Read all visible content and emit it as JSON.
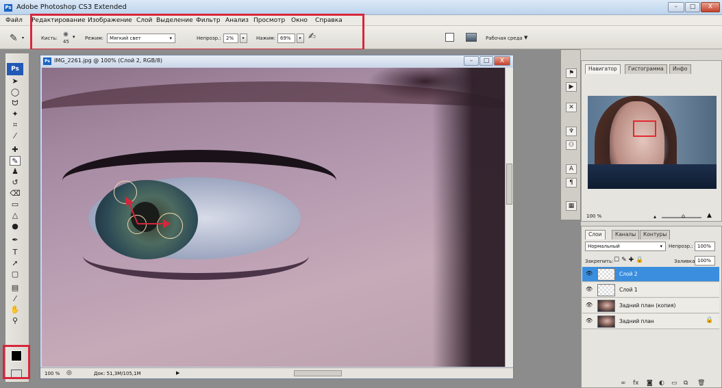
{
  "app": {
    "logo": "Ps",
    "title": "Adobe Photoshop CS3 Extended",
    "window_controls": [
      "–",
      "□",
      "X"
    ]
  },
  "menu": [
    "Файл",
    "Редактирование",
    "Изображение",
    "Слой",
    "Выделение",
    "Фильтр",
    "Анализ",
    "Просмотр",
    "Окно",
    "Справка"
  ],
  "options": {
    "brush_label": "Кисть:",
    "brush_size": "45",
    "mode_label": "Режим:",
    "mode_value": "Мягкий свет",
    "opacity_label": "Непрозр.:",
    "opacity_value": "2%",
    "pressure_label": "Нажим:",
    "pressure_value": "69%",
    "workspace_label": "Рабочая среда"
  },
  "document": {
    "title": "IMG_2261.jpg @ 100% (Слой 2, RGB/8)",
    "zoom": "100 %",
    "doc_size": "Док: 51,3M/105,1M"
  },
  "navigator": {
    "tabs": [
      "Навигатор",
      "Гистограмма",
      "Инфо"
    ],
    "zoom": "100 %"
  },
  "layers_panel": {
    "tabs": [
      "Слои",
      "Каналы",
      "Контуры"
    ],
    "blend_mode": "Нормальный",
    "opacity_label": "Непрозр.:",
    "opacity_value": "100%",
    "lock_label": "Закрепить:",
    "fill_label": "Заливка:",
    "fill_value": "100%",
    "layers": [
      {
        "name": "Слой 2",
        "selected": true,
        "thumb": "transparent"
      },
      {
        "name": "Слой 1",
        "selected": false,
        "thumb": "transparent"
      },
      {
        "name": "Задний план (копия)",
        "selected": false,
        "thumb": "photo"
      },
      {
        "name": "Задний план",
        "selected": false,
        "thumb": "photo",
        "locked": true
      }
    ]
  },
  "colors": {
    "highlight": "#d6263a",
    "selection": "#3b8ede"
  }
}
